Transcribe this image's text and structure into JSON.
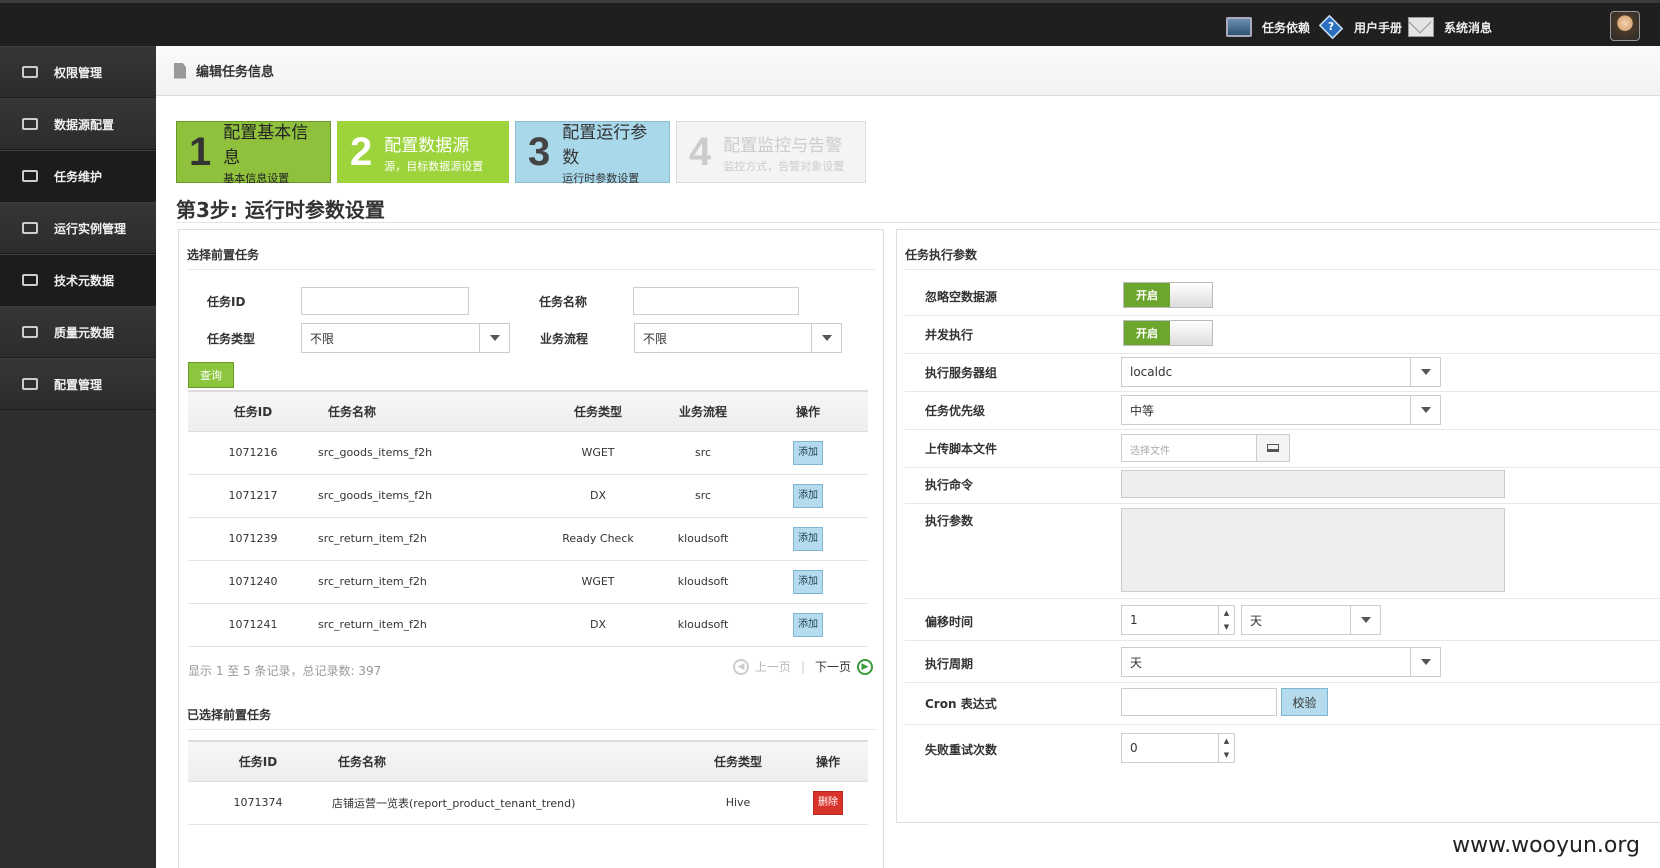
{
  "topbar": {
    "items": [
      {
        "label": "任务依赖",
        "icon": "monitor-icon"
      },
      {
        "label": "用户手册",
        "icon": "help-icon"
      },
      {
        "label": "系统消息",
        "icon": "mail-icon"
      }
    ]
  },
  "sidebar": {
    "items": [
      {
        "label": "权限管理"
      },
      {
        "label": "数据源配置"
      },
      {
        "label": "任务维护"
      },
      {
        "label": "运行实例管理"
      },
      {
        "label": "技术元数据"
      },
      {
        "label": "质量元数据"
      },
      {
        "label": "配置管理"
      }
    ]
  },
  "page": {
    "title": "编辑任务信息",
    "step_title": "第3步: 运行时参数设置"
  },
  "steps": [
    {
      "num": "1",
      "title": "配置基本信息",
      "sub": "基本信息设置"
    },
    {
      "num": "2",
      "title": "配置数据源",
      "sub": "源，目标数据源设置"
    },
    {
      "num": "3",
      "title": "配置运行参数",
      "sub": "运行时参数设置"
    },
    {
      "num": "4",
      "title": "配置监控与告警",
      "sub": "监控方式，告警对象设置"
    }
  ],
  "left": {
    "title": "选择前置任务",
    "filter": {
      "task_id_label": "任务ID",
      "task_name_label": "任务名称",
      "task_type_label": "任务类型",
      "task_type_value": "不限",
      "flow_label": "业务流程",
      "flow_value": "不限",
      "query_label": "查询"
    },
    "columns": [
      "任务ID",
      "任务名称",
      "任务类型",
      "业务流程",
      "操作"
    ],
    "rows": [
      {
        "id": "1071216",
        "name": "src_goods_items_f2h",
        "type": "WGET",
        "flow": "src",
        "op": "添加"
      },
      {
        "id": "1071217",
        "name": "src_goods_items_f2h",
        "type": "DX",
        "flow": "src",
        "op": "添加"
      },
      {
        "id": "1071239",
        "name": "src_return_item_f2h",
        "type": "Ready Check",
        "flow": "kloudsoft",
        "op": "添加"
      },
      {
        "id": "1071240",
        "name": "src_return_item_f2h",
        "type": "WGET",
        "flow": "kloudsoft",
        "op": "添加"
      },
      {
        "id": "1071241",
        "name": "src_return_item_f2h",
        "type": "DX",
        "flow": "kloudsoft",
        "op": "添加"
      }
    ],
    "pager": {
      "info": "显示 1 至 5 条记录，总记录数: 397",
      "prev": "上一页",
      "next": "下一页"
    },
    "selected_title": "已选择前置任务",
    "selected_columns": [
      "任务ID",
      "任务名称",
      "任务类型",
      "操作"
    ],
    "selected_rows": [
      {
        "id": "1071374",
        "name": "店铺运营一览表(report_product_tenant_trend)",
        "type": "Hive",
        "op": "删除"
      }
    ]
  },
  "right": {
    "title": "任务执行参数",
    "fields": {
      "ignore_empty": {
        "label": "忽略空数据源",
        "value": "开启"
      },
      "concurrent": {
        "label": "并发执行",
        "value": "开启"
      },
      "server_group": {
        "label": "执行服务器组",
        "value": "localdc"
      },
      "priority": {
        "label": "任务优先级",
        "value": "中等"
      },
      "upload": {
        "label": "上传脚本文件",
        "placeholder": "选择文件"
      },
      "command": {
        "label": "执行命令"
      },
      "params": {
        "label": "执行参数"
      },
      "offset": {
        "label": "偏移时间",
        "value": "1",
        "unit": "天"
      },
      "period": {
        "label": "执行周期",
        "value": "天"
      },
      "cron": {
        "label": "Cron 表达式",
        "button": "校验"
      },
      "retry": {
        "label": "失败重试次数",
        "value": "0"
      }
    }
  },
  "watermark": "www.wooyun.org"
}
